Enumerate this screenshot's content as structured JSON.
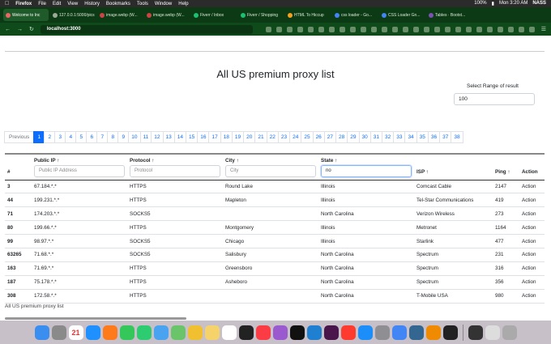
{
  "menubar": {
    "items": [
      "Firefox",
      "File",
      "Edit",
      "View",
      "History",
      "Bookmarks",
      "Tools",
      "Window",
      "Help"
    ],
    "battery": "100%",
    "clock": "Mon 3:20 AM",
    "user": "NASS"
  },
  "tabs": [
    {
      "label": "Welcome to Inc",
      "active": true
    },
    {
      "label": "127.0.0.1:5000/pics",
      "active": false
    },
    {
      "label": "image.webp (W...",
      "active": false
    },
    {
      "label": "image.webp (W...",
      "active": false
    },
    {
      "label": "Fiverr / Inbox",
      "active": false
    },
    {
      "label": "Fiverr / Shopping",
      "active": false
    },
    {
      "label": "HTML To Hiccup",
      "active": false
    },
    {
      "label": "css loader - Go...",
      "active": false
    },
    {
      "label": "CSS Loader Gn...",
      "active": false
    },
    {
      "label": "Tables · Bootst...",
      "active": false
    }
  ],
  "url": "localhost:3000",
  "page": {
    "title": "All US premium proxy list",
    "range_label": "Select Range of result",
    "range_value": "100",
    "footer": "All US premium proxy list"
  },
  "pagination": {
    "prev": "Previous",
    "pages": [
      "1",
      "2",
      "3",
      "4",
      "5",
      "6",
      "7",
      "8",
      "9",
      "10",
      "11",
      "12",
      "13",
      "14",
      "15",
      "16",
      "17",
      "18",
      "19",
      "20",
      "21",
      "22",
      "23",
      "24",
      "25",
      "26",
      "27",
      "28",
      "29",
      "30",
      "31",
      "32",
      "33",
      "34",
      "35",
      "36",
      "37",
      "38"
    ],
    "active": "1"
  },
  "table": {
    "headers": {
      "num": "#",
      "ip": "Public IP ↑",
      "protocol": "Protocol ↑",
      "city": "City ↑",
      "state": "State ↑",
      "isp": "ISP ↑",
      "ping": "Ping ↑",
      "action": "Action"
    },
    "filters": {
      "ip_placeholder": "Public IP Address",
      "protocol_placeholder": "Protocol",
      "city_placeholder": "City",
      "state_value": "no"
    },
    "rows": [
      {
        "num": "3",
        "ip": "67.184.*.*",
        "protocol": "HTTPS",
        "city": "Round Lake",
        "state": "Illinois",
        "isp": "Comcast Cable",
        "ping": "2147",
        "action": "Action"
      },
      {
        "num": "44",
        "ip": "199.231.*.*",
        "protocol": "HTTPS",
        "city": "Mapleton",
        "state": "Illinois",
        "isp": "Tel-Star Communications",
        "ping": "419",
        "action": "Action"
      },
      {
        "num": "71",
        "ip": "174.203.*.*",
        "protocol": "SOCKS5",
        "city": "",
        "state": "North Carolina",
        "isp": "Verizon Wireless",
        "ping": "273",
        "action": "Action"
      },
      {
        "num": "80",
        "ip": "199.66.*.*",
        "protocol": "HTTPS",
        "city": "Montgomery",
        "state": "Illinois",
        "isp": "Metronet",
        "ping": "1164",
        "action": "Action"
      },
      {
        "num": "99",
        "ip": "98.97.*.*",
        "protocol": "SOCKS5",
        "city": "Chicago",
        "state": "Illinois",
        "isp": "Starlink",
        "ping": "477",
        "action": "Action"
      },
      {
        "num": "63265",
        "ip": "71.68.*.*",
        "protocol": "SOCKS5",
        "city": "Salisbury",
        "state": "North Carolina",
        "isp": "Spectrum",
        "ping": "231",
        "action": "Action"
      },
      {
        "num": "163",
        "ip": "71.69.*.*",
        "protocol": "HTTPS",
        "city": "Greensboro",
        "state": "North Carolina",
        "isp": "Spectrum",
        "ping": "316",
        "action": "Action"
      },
      {
        "num": "187",
        "ip": "75.178.*.*",
        "protocol": "HTTPS",
        "city": "Asheboro",
        "state": "North Carolina",
        "isp": "Spectrum",
        "ping": "356",
        "action": "Action"
      },
      {
        "num": "308",
        "ip": "172.58.*.*",
        "protocol": "HTTPS",
        "city": "",
        "state": "North Carolina",
        "isp": "T-Mobile USA",
        "ping": "980",
        "action": "Action"
      }
    ]
  },
  "dock": {
    "apps": [
      "finder-icon",
      "launchpad-icon",
      "calendar-icon",
      "safari-icon",
      "firefox-icon",
      "messages-icon",
      "facetime-icon",
      "mail-icon",
      "maps-icon",
      "photos-icon",
      "notes-icon",
      "reminders-icon",
      "stocks-icon",
      "music-icon",
      "podcasts-icon",
      "appletv-icon",
      "vscode-icon",
      "slack-icon",
      "news-icon",
      "appstore-icon",
      "settings-icon",
      "chrome-icon",
      "pgadmin-icon",
      "vlc-icon",
      "terminal-icon",
      "activity-monitor-icon",
      "documents-icon",
      "trash-icon"
    ],
    "colors": [
      "#3a8ef0",
      "#8a8a8a",
      "#ffffff",
      "#1e90ff",
      "#ff7a1a",
      "#34c759",
      "#2ecc71",
      "#4aa3f0",
      "#6ac46a",
      "#f0c030",
      "#f5d36a",
      "#ffffff",
      "#222222",
      "#fc3c44",
      "#9b59d0",
      "#111111",
      "#1f7fd0",
      "#4a154b",
      "#ff3b30",
      "#1c8ef9",
      "#8e8e93",
      "#4285f4",
      "#336791",
      "#f08a00",
      "#222222",
      "#333333",
      "#dddddd",
      "#aaaaaa"
    ],
    "calendar_day": "21"
  }
}
